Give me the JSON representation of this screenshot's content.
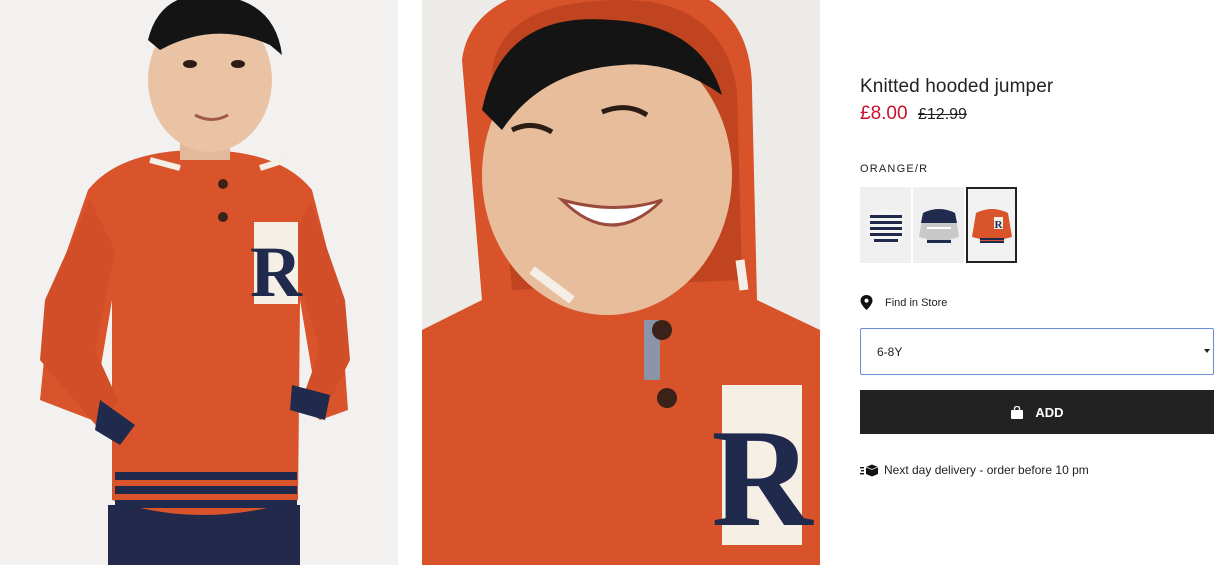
{
  "product": {
    "title": "Knitted hooded jumper",
    "sale_price": "£8.00",
    "original_price": "£12.99",
    "color_label": "ORANGE/R"
  },
  "swatches": [
    {
      "name": "navy-white-stripe",
      "selected": false
    },
    {
      "name": "navy-grey-colourblock",
      "selected": false
    },
    {
      "name": "orange-r",
      "selected": true
    }
  ],
  "store": {
    "label": "Find in Store",
    "icon": "location-pin-icon"
  },
  "size_select": {
    "value": "6-8Y"
  },
  "add_button": {
    "label": "ADD",
    "icon": "shopping-bag-icon"
  },
  "delivery": {
    "text": "Next day delivery - order before 10 pm",
    "icon": "delivery-truck-icon"
  },
  "colors": {
    "sale": "#c8102e",
    "button": "#222222",
    "select_border": "#6b8dd6"
  }
}
